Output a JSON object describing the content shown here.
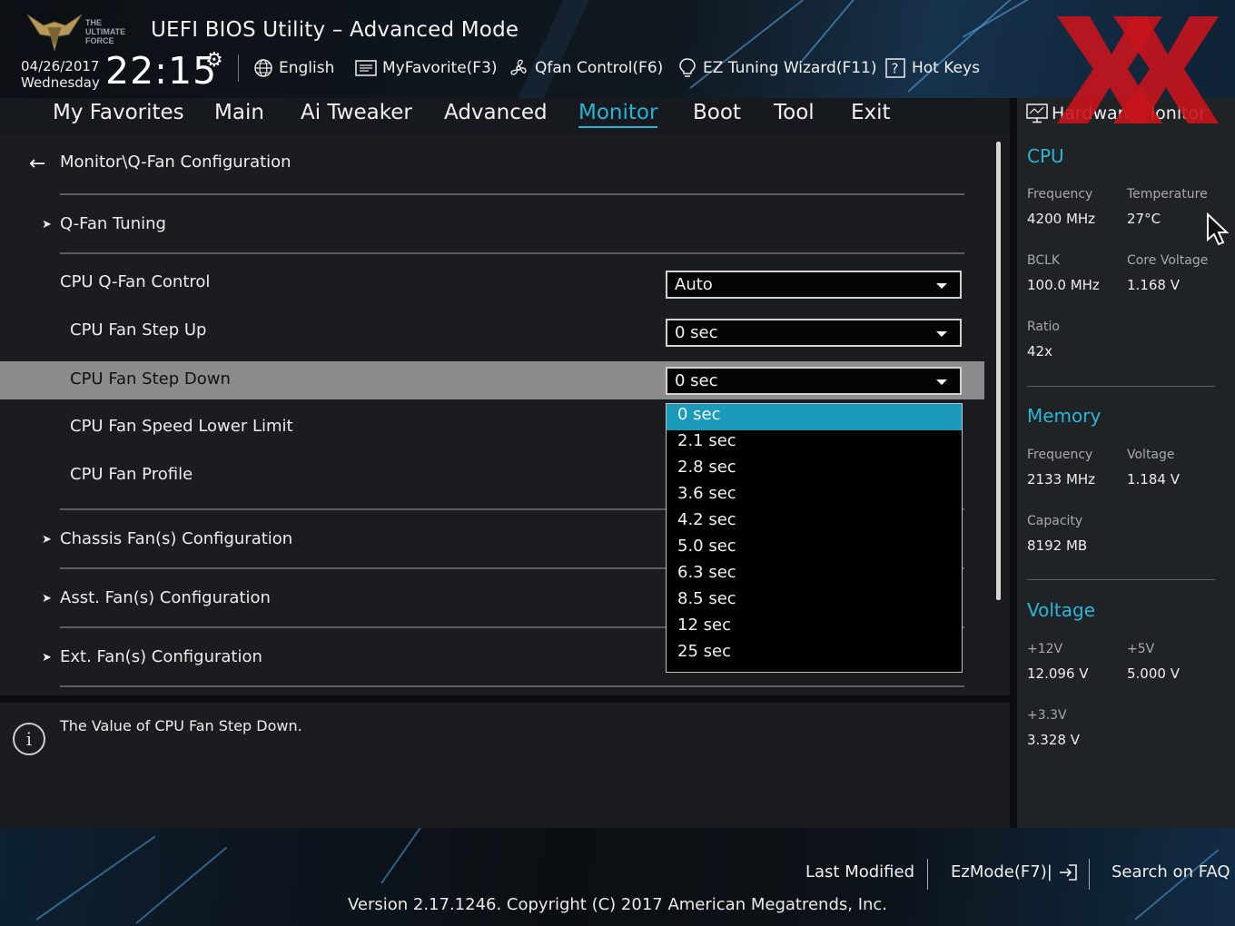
{
  "header": {
    "title": "UEFI BIOS Utility – Advanced Mode",
    "logo_text": "THE ULTIMATE FORCE",
    "date": "04/26/2017",
    "weekday": "Wednesday",
    "time": "22:15",
    "toolbar": {
      "language": "English",
      "favorite": "MyFavorite(F3)",
      "qfan": "Qfan Control(F6)",
      "ez_tuning": "EZ Tuning Wizard(F11)",
      "hot_keys": "Hot Keys"
    }
  },
  "menu": {
    "tabs": [
      "My Favorites",
      "Main",
      "Ai Tweaker",
      "Advanced",
      "Monitor",
      "Boot",
      "Tool",
      "Exit"
    ],
    "active": "Monitor"
  },
  "main": {
    "breadcrumb": "Monitor\\Q-Fan Configuration",
    "qfan_tuning": "Q-Fan Tuning",
    "settings": {
      "cpu_qfan_control": {
        "label": "CPU Q-Fan Control",
        "value": "Auto"
      },
      "cpu_fan_step_up": {
        "label": "CPU Fan Step Up",
        "value": "0 sec"
      },
      "cpu_fan_step_down": {
        "label": "CPU Fan Step Down",
        "value": "0 sec"
      },
      "cpu_fan_speed_lower_limit": {
        "label": "CPU Fan Speed Lower Limit"
      },
      "cpu_fan_profile": {
        "label": "CPU Fan Profile"
      }
    },
    "submenus": {
      "chassis": "Chassis Fan(s) Configuration",
      "asst": "Asst. Fan(s) Configuration",
      "ext": "Ext. Fan(s) Configuration"
    },
    "dropdown_options": [
      "0 sec",
      "2.1 sec",
      "2.8 sec",
      "3.6 sec",
      "4.2 sec",
      "5.0 sec",
      "6.3 sec",
      "8.5 sec",
      "12 sec",
      "25 sec"
    ],
    "dropdown_selected": "0 sec"
  },
  "info": {
    "icon_glyph": "i",
    "text": "The Value of CPU Fan Step Down."
  },
  "hw_monitor": {
    "title": "Hardware Monitor",
    "cpu": {
      "heading": "CPU",
      "frequency_label": "Frequency",
      "frequency": "4200 MHz",
      "temperature_label": "Temperature",
      "temperature": "27°C",
      "bclk_label": "BCLK",
      "bclk": "100.0 MHz",
      "core_voltage_label": "Core Voltage",
      "core_voltage": "1.168 V",
      "ratio_label": "Ratio",
      "ratio": "42x"
    },
    "memory": {
      "heading": "Memory",
      "frequency_label": "Frequency",
      "frequency": "2133 MHz",
      "voltage_label": "Voltage",
      "voltage": "1.184 V",
      "capacity_label": "Capacity",
      "capacity": "8192 MB"
    },
    "voltage": {
      "heading": "Voltage",
      "v12_label": "+12V",
      "v12": "12.096 V",
      "v5_label": "+5V",
      "v5": "5.000 V",
      "v33_label": "+3.3V",
      "v33": "3.328 V"
    }
  },
  "footer": {
    "last_modified": "Last Modified",
    "ezmode": "EzMode(F7)|",
    "search_faq": "Search on FAQ",
    "version": "Version 2.17.1246. Copyright (C) 2017 American Megatrends, Inc."
  },
  "colors": {
    "accent": "#27b4d6",
    "highlight": "#1b9aba",
    "selected_row": "#8b8c8e",
    "watermark": "#c8141c"
  }
}
